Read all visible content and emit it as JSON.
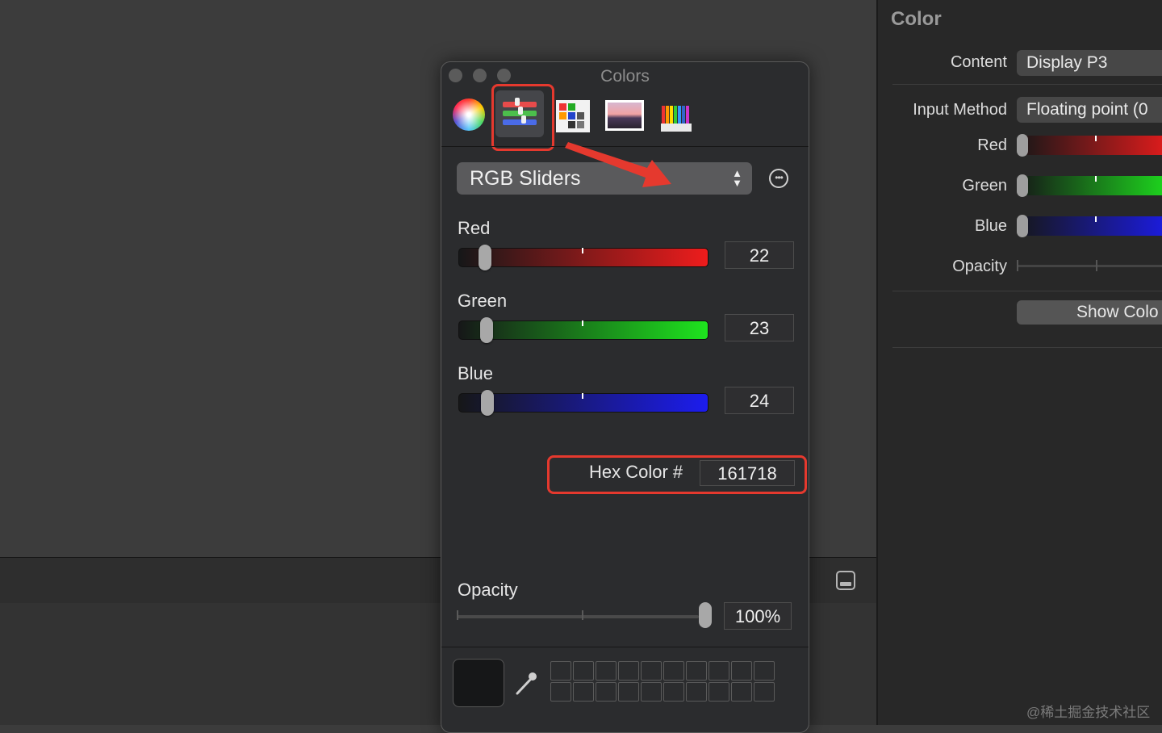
{
  "panel": {
    "title": "Colors",
    "tools": [
      "color-wheel",
      "color-sliders",
      "color-palettes",
      "image-palettes",
      "pencils"
    ],
    "mode_popup": "RGB Sliders",
    "sliders": [
      {
        "label": "Red",
        "value": "22",
        "level": 0.086
      },
      {
        "label": "Green",
        "value": "23",
        "level": 0.09
      },
      {
        "label": "Blue",
        "value": "24",
        "level": 0.094
      }
    ],
    "hex_label": "Hex Color #",
    "hex_value": "161718",
    "opacity_label": "Opacity",
    "opacity_value": "100%",
    "current_color": "#161718",
    "highlight_color": "#e5392e"
  },
  "inspector": {
    "title": "Color",
    "content_label": "Content",
    "content_value": "Display P3",
    "input_method_label": "Input Method",
    "input_method_value": "Floating point (0",
    "red_label": "Red",
    "green_label": "Green",
    "blue_label": "Blue",
    "opacity_label": "Opacity",
    "show_colors_button": "Show Colo"
  },
  "watermark": "@稀土掘金技术社区"
}
